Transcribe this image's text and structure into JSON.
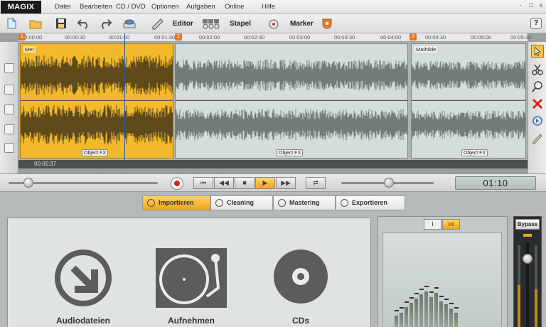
{
  "app": {
    "logo": "MAGIX",
    "menu": [
      "Datei",
      "Bearbeiten",
      "CD / DVD",
      "Optionen",
      "Aufgaben",
      "Online",
      "Hilfe"
    ],
    "window_controls": [
      "-",
      "□",
      "x"
    ]
  },
  "toolbar": {
    "editor_label": "Editor",
    "stapel_label": "Stapel",
    "marker_label": "Marker",
    "help_label": "?"
  },
  "timeline": {
    "ticks": [
      "00:00:00",
      "00:00:30",
      "00:01:00",
      "00:01:30",
      "00:02:00",
      "00:02:30",
      "00:03:00",
      "00:03:30",
      "00:04:00",
      "00:04:30",
      "00:05:00",
      "00:05:30"
    ],
    "markers": [
      "1",
      "2",
      "3"
    ],
    "clips": [
      {
        "name": "Mer",
        "fx_label": "Object FX",
        "color": "#f3b92c"
      },
      {
        "name": "",
        "fx_label": "Object FX",
        "color": "#d4dcdc"
      },
      {
        "name": "Mathilde",
        "fx_label": "Object FX",
        "color": "#d4dcdc"
      }
    ],
    "status_time": "00:05:37"
  },
  "transport": {
    "time_display": "01:10",
    "buttons": [
      "⏮",
      "◀◀",
      "■",
      "▶",
      "▶▶",
      "⇄"
    ]
  },
  "tabs": [
    {
      "label": "Importieren",
      "active": true
    },
    {
      "label": "Cleaning",
      "active": false
    },
    {
      "label": "Mastering",
      "active": false
    },
    {
      "label": "Exportieren",
      "active": false
    }
  ],
  "import_items": [
    {
      "label": "Audiodateien",
      "icon": "download-arrow-icon"
    },
    {
      "label": "Aufnehmen",
      "icon": "turntable-icon"
    },
    {
      "label": "CDs",
      "icon": "cd-icon"
    }
  ],
  "meter": {
    "tab_info": "i",
    "tab_bars": "ııı"
  },
  "bypass": {
    "label": "Bypass"
  },
  "colors": {
    "accent": "#f0a41d",
    "clip_selected": "#f3b92c",
    "clip_normal": "#d4dcdc",
    "record": "#dd2222"
  }
}
